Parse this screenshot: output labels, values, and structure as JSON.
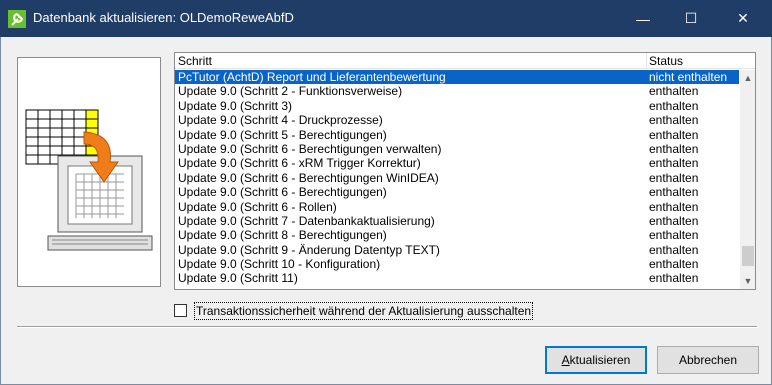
{
  "window": {
    "title": "Datenbank aktualisieren: OLDemoReweAbfD",
    "app_icon": "wrench-icon",
    "minimize_label": "—",
    "maximize_label": "☐",
    "close_label": "✕"
  },
  "list": {
    "columns": [
      "Schritt",
      "Status"
    ],
    "rows": [
      {
        "step": "PcTutor  (AchtD) Report und Lieferantenbewertung",
        "status": "nicht enthalten",
        "selected": true
      },
      {
        "step": "Update 9.0 (Schritt 2 - Funktionsverweise)",
        "status": "enthalten"
      },
      {
        "step": "Update 9.0 (Schritt 3)",
        "status": "enthalten"
      },
      {
        "step": "Update 9.0 (Schritt 4 - Druckprozesse)",
        "status": "enthalten"
      },
      {
        "step": "Update 9.0 (Schritt 5 - Berechtigungen)",
        "status": "enthalten"
      },
      {
        "step": "Update 9.0 (Schritt 6 - Berechtigungen verwalten)",
        "status": "enthalten"
      },
      {
        "step": "Update 9.0 (Schritt 6 - xRM Trigger Korrektur)",
        "status": "enthalten"
      },
      {
        "step": "Update 9.0 (Schritt 6 - Berechtigungen WinIDEA)",
        "status": "enthalten"
      },
      {
        "step": "Update 9.0 (Schritt 6 - Berechtigungen)",
        "status": "enthalten"
      },
      {
        "step": "Update 9.0 (Schritt 6 - Rollen)",
        "status": "enthalten"
      },
      {
        "step": "Update 9.0 (Schritt 7 - Datenbankaktualisierung)",
        "status": "enthalten"
      },
      {
        "step": "Update 9.0 (Schritt 8 - Berechtigungen)",
        "status": "enthalten"
      },
      {
        "step": "Update 9.0 (Schritt 9 - Änderung Datentyp TEXT)",
        "status": "enthalten"
      },
      {
        "step": "Update 9.0 (Schritt 10 - Konfiguration)",
        "status": "enthalten"
      },
      {
        "step": "Update 9.0 (Schritt 11)",
        "status": "enthalten"
      }
    ]
  },
  "options": {
    "disable_transaction_label": "Transaktionssicherheit während der Aktualisierung ausschalten",
    "disable_transaction_checked": false
  },
  "buttons": {
    "update_label_accel": "A",
    "update_label_rest": "ktualisieren",
    "cancel_label": "Abbrechen"
  },
  "colors": {
    "titlebar": "#1f3d66",
    "selection": "#0a64c8",
    "icon_green": "#6abf2c"
  }
}
